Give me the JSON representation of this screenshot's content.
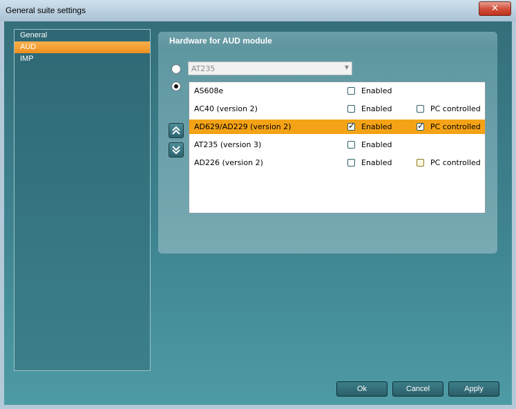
{
  "window": {
    "title": "General suite settings",
    "close_glyph": "✕"
  },
  "nav": {
    "items": [
      {
        "label": "General"
      },
      {
        "label": "AUD",
        "selected": true
      },
      {
        "label": "IMP"
      }
    ]
  },
  "panel": {
    "title": "Hardware for AUD module"
  },
  "combo": {
    "value": "AT235"
  },
  "radios": {
    "combo_selected": false,
    "list_selected": true
  },
  "devices": [
    {
      "name": "AS608e",
      "enabled_label": "Enabled",
      "enabled": false,
      "pc_label": "",
      "pc": null,
      "selected": false
    },
    {
      "name": "AC40 (version 2)",
      "enabled_label": "Enabled",
      "enabled": false,
      "pc_label": "PC controlled",
      "pc": false,
      "selected": false
    },
    {
      "name": "AD629/AD229 (version 2)",
      "enabled_label": "Enabled",
      "enabled": true,
      "pc_label": "PC controlled",
      "pc": true,
      "selected": true
    },
    {
      "name": "AT235 (version 3)",
      "enabled_label": "Enabled",
      "enabled": false,
      "pc_label": "",
      "pc": null,
      "selected": false
    },
    {
      "name": "AD226 (version 2)",
      "enabled_label": "Enabled",
      "enabled": false,
      "pc_label": "PC controlled",
      "pc": false,
      "selected": false
    }
  ],
  "buttons": {
    "ok": "Ok",
    "cancel": "Cancel",
    "apply": "Apply"
  },
  "icons": {
    "move_up": "double-chevron-up-icon",
    "move_down": "double-chevron-down-icon"
  },
  "colors": {
    "accent_orange": "#f5a316",
    "nav_selection": "#f28f1e",
    "teal_bg": "#3e8490"
  }
}
